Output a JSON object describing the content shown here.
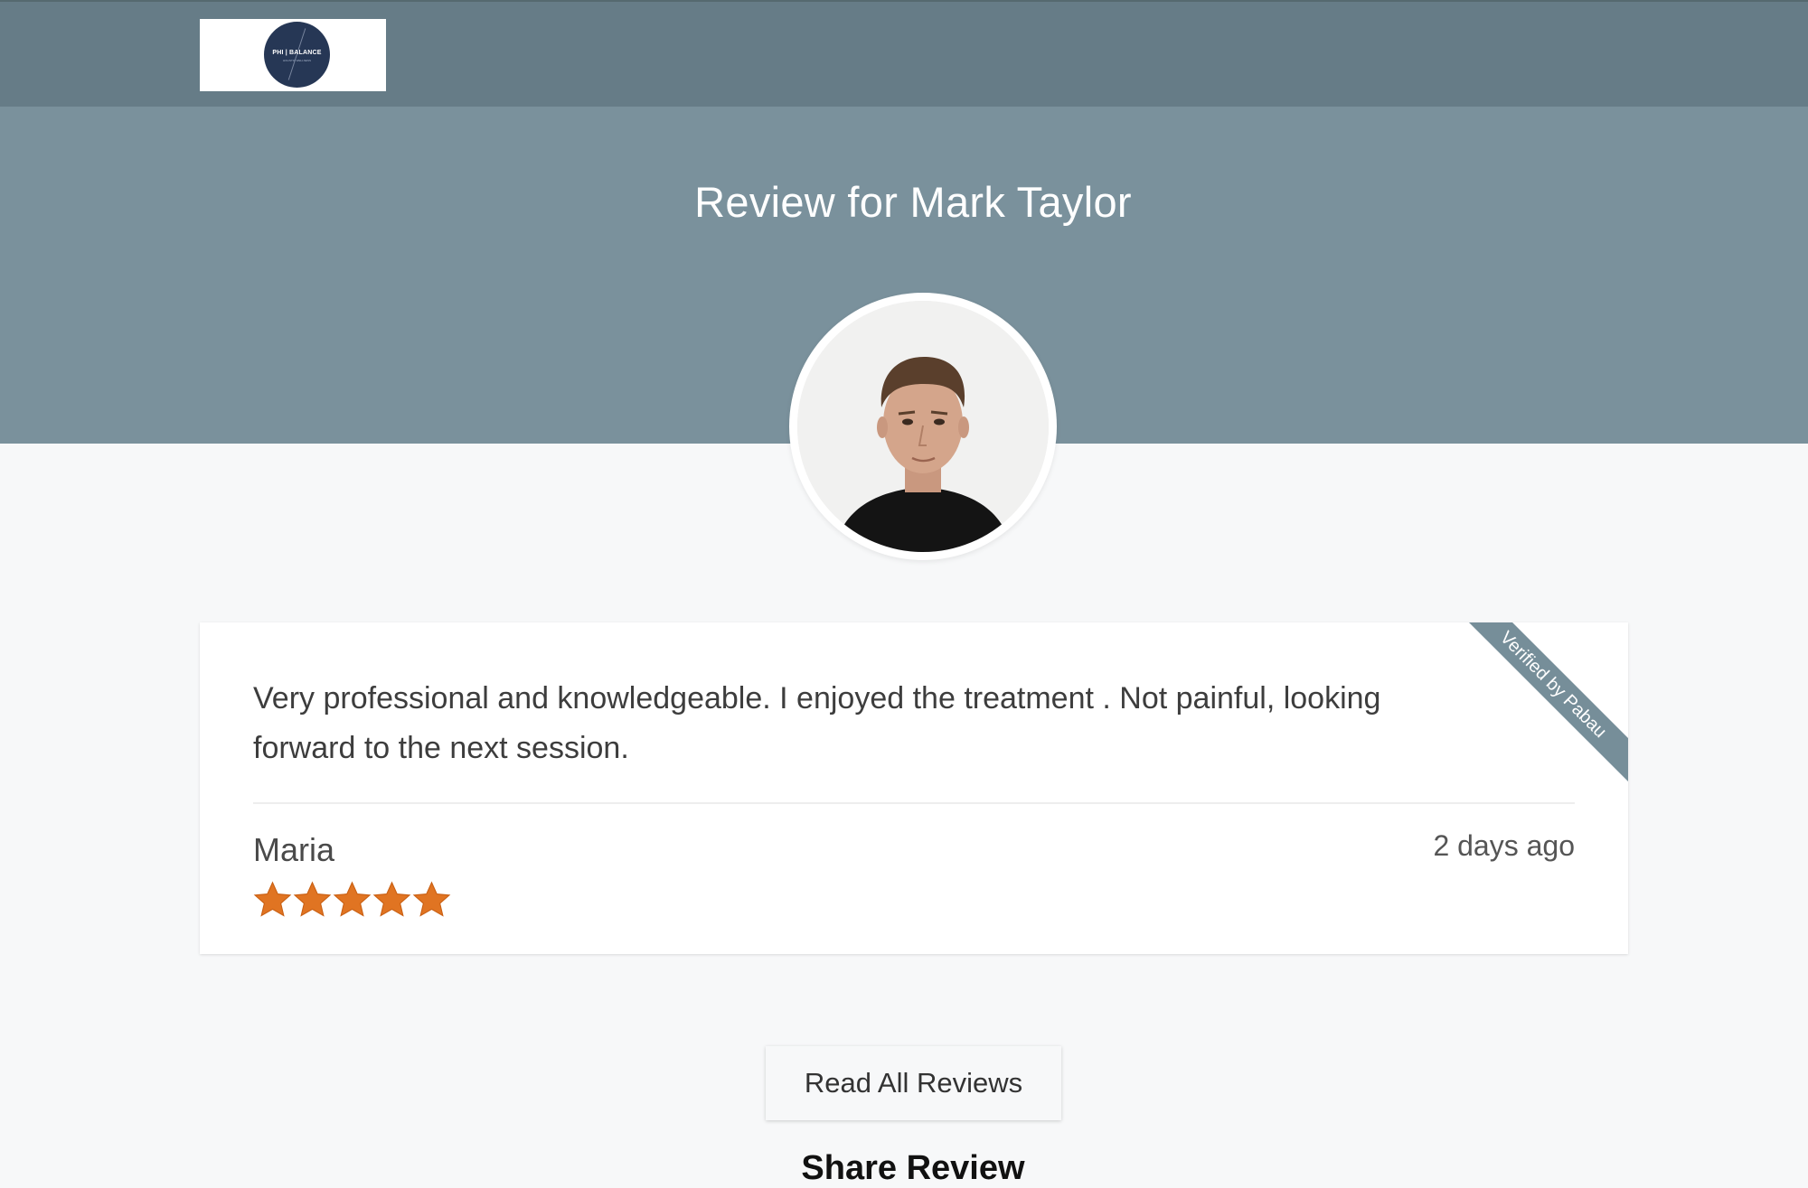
{
  "header": {
    "logo": {
      "text": "PHI | BALANCE",
      "subtext": "HOLISTIC WELLNESS",
      "color": "#263755"
    },
    "background": "#667c87"
  },
  "hero": {
    "title": "Review for Mark Taylor",
    "background": "#7a919c"
  },
  "review": {
    "text": "Very professional and knowledgeable. I enjoyed the treatment . Not painful, looking forward to the next session.",
    "reviewer": "Maria",
    "date": "2 days ago",
    "rating": 5,
    "rating_max": 5,
    "ribbon": "Verified by Pabau",
    "star_color": "#e07422"
  },
  "actions": {
    "read_all_label": "Read All Reviews"
  },
  "share": {
    "heading": "Share Review"
  }
}
